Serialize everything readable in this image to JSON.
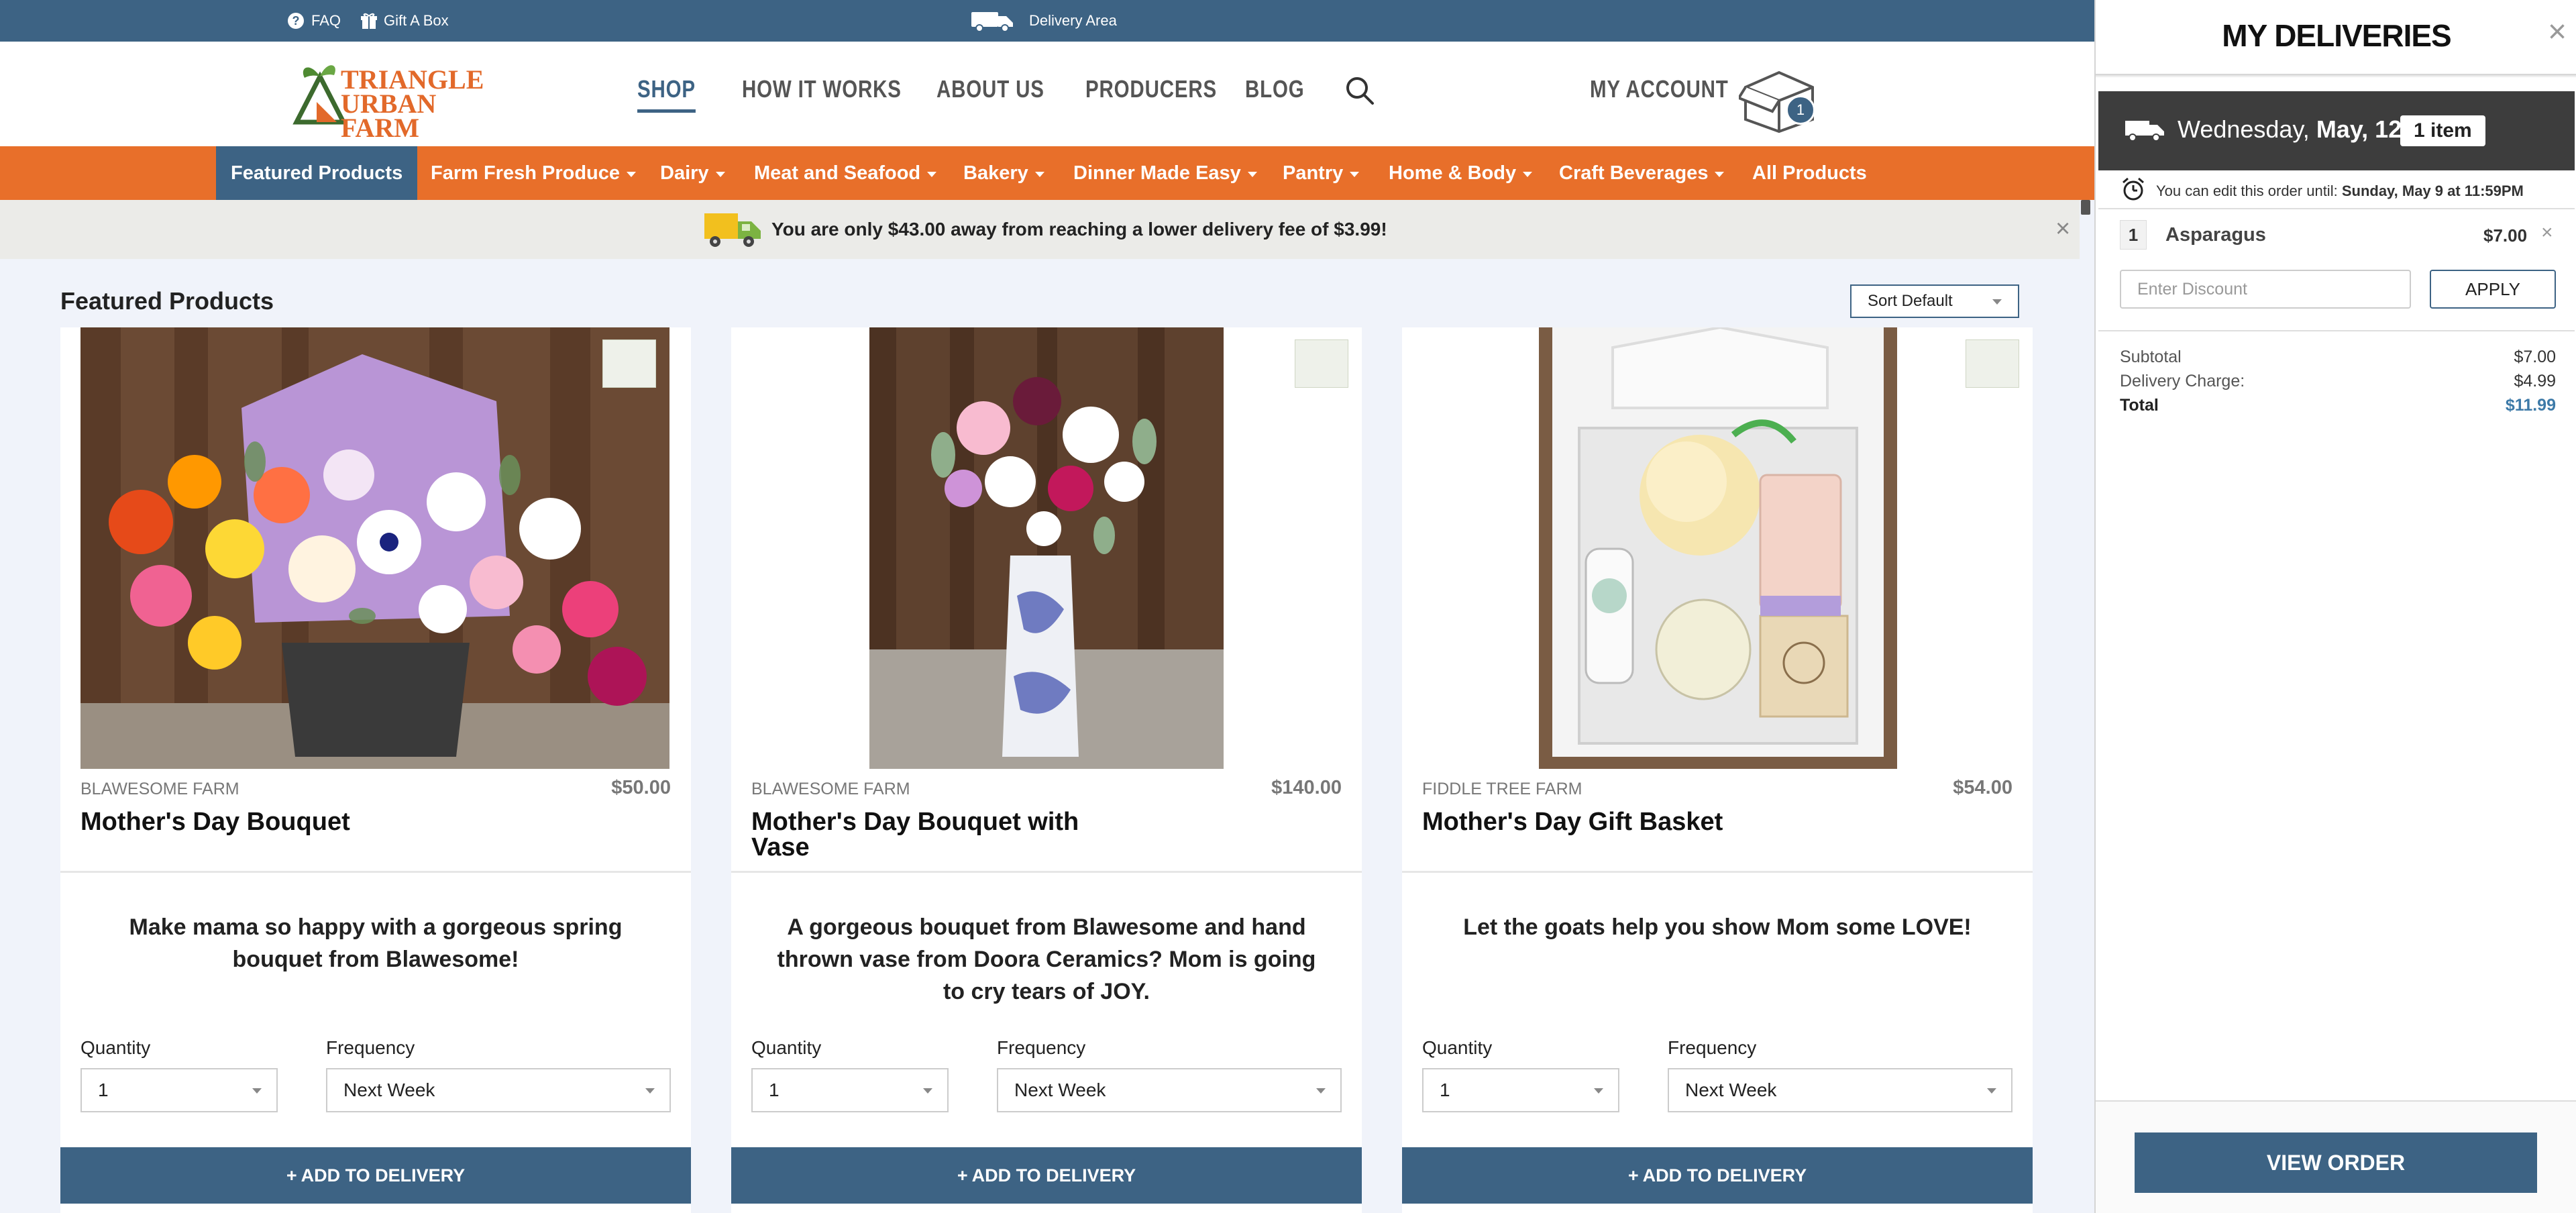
{
  "topbar": {
    "faq": "FAQ",
    "gift": "Gift A Box",
    "delivery_area": "Delivery Area"
  },
  "logo": {
    "line1": "TRIANGLE",
    "line2": "URBAN",
    "line3": "FARM"
  },
  "nav": {
    "shop": "SHOP",
    "how": "HOW IT WORKS",
    "about": "ABOUT US",
    "producers": "PRODUCERS",
    "blog": "BLOG",
    "account": "MY ACCOUNT",
    "cart_count": "1"
  },
  "categories": [
    "Featured Products",
    "Farm Fresh Produce",
    "Dairy",
    "Meat and Seafood",
    "Bakery",
    "Dinner Made Easy",
    "Pantry",
    "Home & Body",
    "Craft Beverages",
    "All Products"
  ],
  "notice": {
    "text": "You are only $43.00 away from reaching a lower delivery fee of $3.99!"
  },
  "section": {
    "title": "Featured Products",
    "sort": "Sort Default"
  },
  "labels": {
    "quantity": "Quantity",
    "frequency": "Frequency",
    "add": "ADD TO DELIVERY"
  },
  "products": [
    {
      "farm": "BLAWESOME FARM",
      "price": "$50.00",
      "title": "Mother's Day Bouquet",
      "desc": "Make mama so happy with a gorgeous spring bouquet from Blawesome!",
      "qty": "1",
      "freq": "Next Week"
    },
    {
      "farm": "BLAWESOME FARM",
      "price": "$140.00",
      "title": "Mother's Day Bouquet with Vase",
      "desc": "A gorgeous bouquet from Blawesome and hand thrown vase from Doora Ceramics? Mom is going to cry tears of JOY.",
      "qty": "1",
      "freq": "Next Week"
    },
    {
      "farm": "FIDDLE TREE FARM",
      "price": "$54.00",
      "title": "Mother's Day Gift Basket",
      "desc": "Let the goats help you show Mom some LOVE!",
      "qty": "1",
      "freq": "Next Week"
    }
  ],
  "panel": {
    "title": "MY DELIVERIES",
    "day": "Wednesday,",
    "date": "May, 12",
    "item_count": "1 item",
    "edit_prefix": "You can edit this order until:",
    "edit_until": "Sunday, May 9 at 11:59PM",
    "item": {
      "qty": "1",
      "name": "Asparagus",
      "price": "$7.00"
    },
    "discount_placeholder": "Enter Discount",
    "apply": "APPLY",
    "subtotal_label": "Subtotal",
    "subtotal": "$7.00",
    "delivery_label": "Delivery Charge:",
    "delivery": "$4.99",
    "total_label": "Total",
    "total": "$11.99",
    "view_order": "VIEW ORDER"
  },
  "colors": {
    "brand_blue": "#3d6384",
    "brand_orange": "#e86f2a",
    "total_blue": "#3d7aa8"
  }
}
